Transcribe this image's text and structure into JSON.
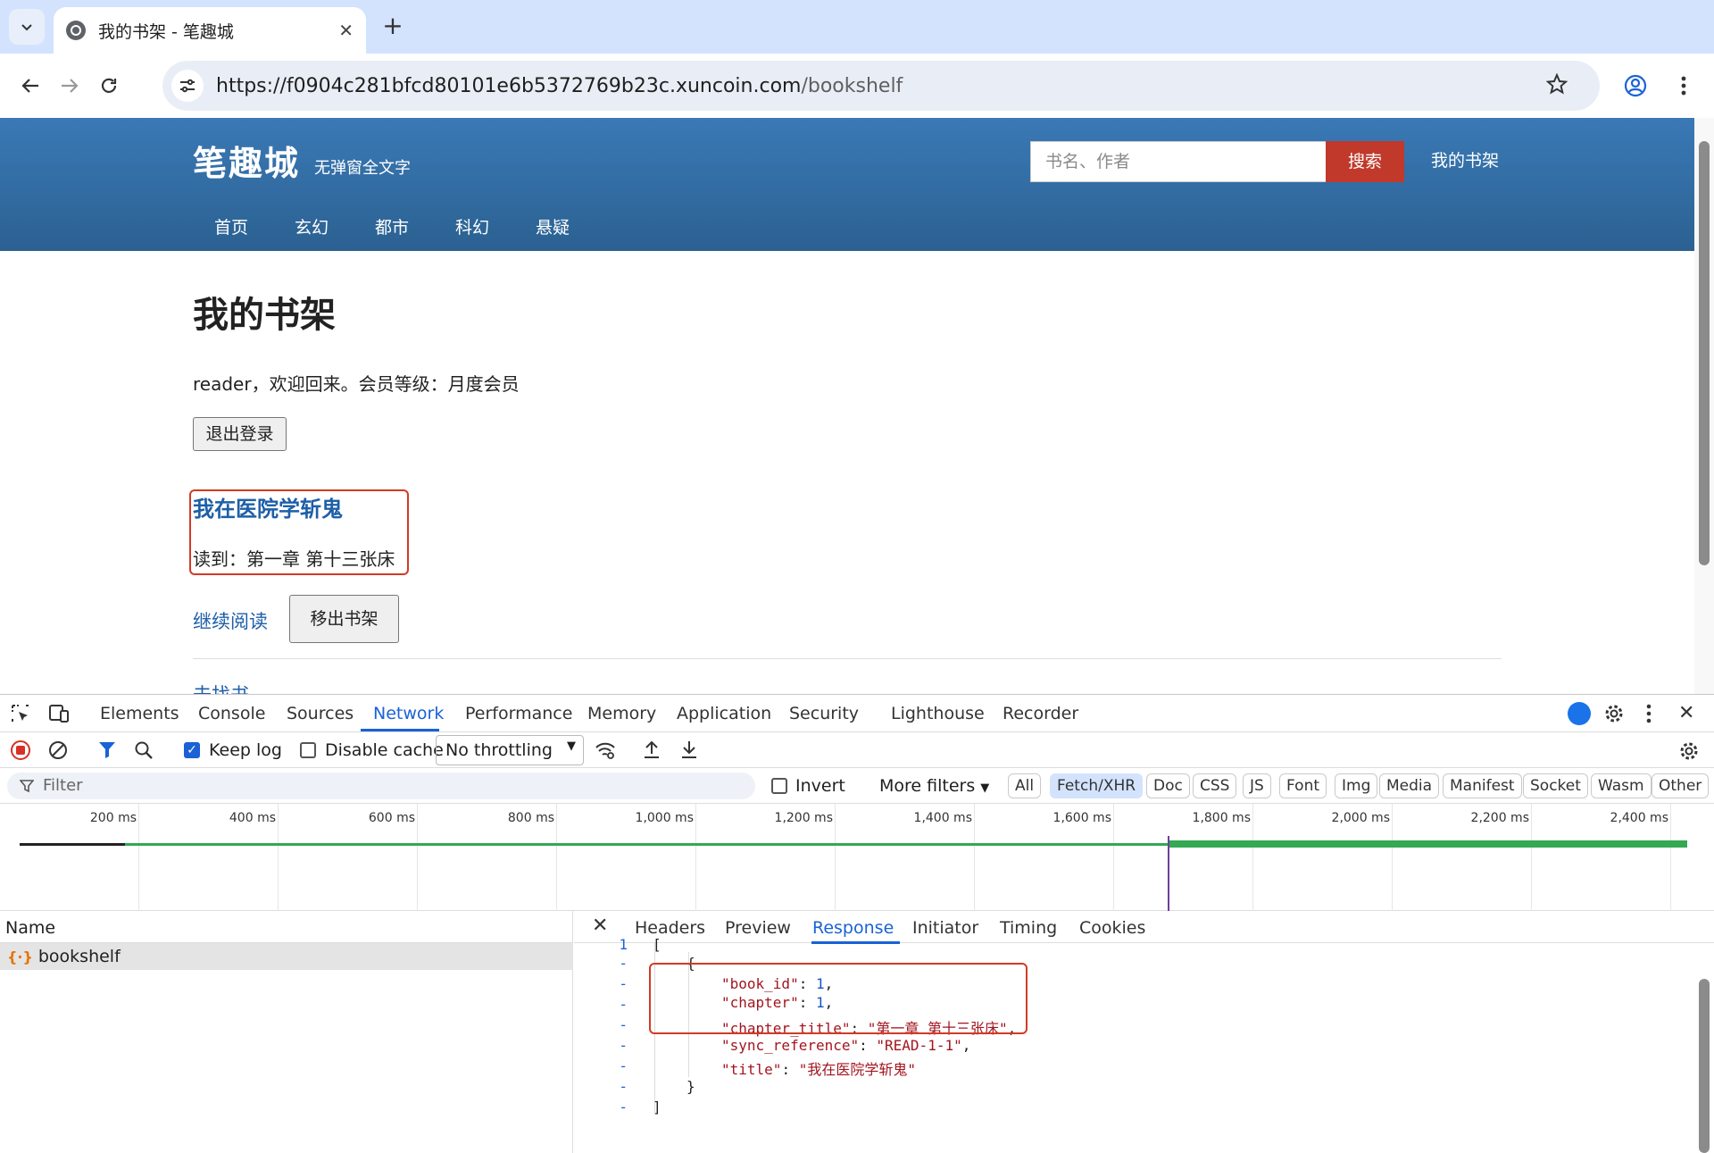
{
  "browser": {
    "tab_title": "我的书架 - 笔趣城",
    "url_host": "https://f0904c281bfcd80101e6b5372769b23c.xuncoin.com",
    "url_path": "/bookshelf"
  },
  "site": {
    "logo": "笔趣城",
    "slogan": "无弹窗全文字",
    "search_placeholder": "书名、作者",
    "search_button": "搜索",
    "my_bookshelf": "我的书架",
    "nav": [
      "首页",
      "玄幻",
      "都市",
      "科幻",
      "悬疑"
    ]
  },
  "main": {
    "heading": "我的书架",
    "welcome": "reader，欢迎回来。会员等级：月度会员",
    "logout_button": "退出登录",
    "book_title": "我在医院学斩鬼",
    "read_to": "读到：第一章 第十三张床",
    "continue_link": "继续阅读",
    "remove_button": "移出书架",
    "find_link": "去找书"
  },
  "devtools": {
    "tabs": [
      "Elements",
      "Console",
      "Sources",
      "Network",
      "Performance",
      "Memory",
      "Application",
      "Security",
      "Lighthouse",
      "Recorder"
    ],
    "active_tab": "Network",
    "keep_log": "Keep log",
    "disable_cache": "Disable cache",
    "throttling": "No throttling",
    "filter_placeholder": "Filter",
    "invert": "Invert",
    "more_filters": "More filters",
    "type_filters": [
      "All",
      "Fetch/XHR",
      "Doc",
      "CSS",
      "JS",
      "Font",
      "Img",
      "Media",
      "Manifest",
      "Socket",
      "Wasm",
      "Other"
    ],
    "active_type_filter": "Fetch/XHR",
    "timeline_ticks": [
      "200 ms",
      "400 ms",
      "600 ms",
      "800 ms",
      "1,000 ms",
      "1,200 ms",
      "1,400 ms",
      "1,600 ms",
      "1,800 ms",
      "2,000 ms",
      "2,200 ms",
      "2,400 ms"
    ],
    "name_header": "Name",
    "request_name": "bookshelf",
    "detail_tabs": [
      "Headers",
      "Preview",
      "Response",
      "Initiator",
      "Timing",
      "Cookies"
    ],
    "active_detail_tab": "Response",
    "response": {
      "line_number": "1",
      "book_id_key": "\"book_id\"",
      "book_id_val": "1",
      "chapter_key": "\"chapter\"",
      "chapter_val": "1",
      "chapter_title_key": "\"chapter_title\"",
      "chapter_title_val": "\"第一章 第十三张床\"",
      "sync_reference_key": "\"sync_reference\"",
      "sync_reference_val": "\"READ-1-1\"",
      "title_key": "\"title\"",
      "title_val": "\"我在医院学斩鬼\""
    }
  },
  "colors": {
    "header_blue": "#2f6aa0",
    "search_red": "#c0392b",
    "link_blue": "#1e5fa8",
    "highlight_red": "#d33a26",
    "devtools_accent": "#1a62d6"
  }
}
